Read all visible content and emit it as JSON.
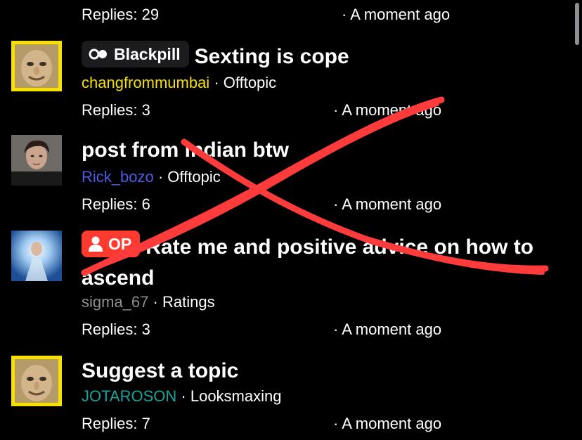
{
  "top_row": {
    "replies": "Replies: 29",
    "time": "· A moment ago"
  },
  "threads": [
    {
      "badge": "Blackpill",
      "title": "Sexting is cope",
      "author": "changfrommumbai",
      "author_color": "#f5e000",
      "category": "Offtopic",
      "replies": "Replies: 3",
      "time": "· A moment ago"
    },
    {
      "title": "post from indian btw",
      "author": "Rick_bozo",
      "author_color": "#4b5de8",
      "category": "Offtopic",
      "replies": "Replies: 6",
      "time": "· A moment ago"
    },
    {
      "badge": "OP",
      "title": "Rate me and positive advice on how to ascend",
      "author": "sigma_67",
      "author_color": "#8e8e93",
      "category": "Ratings",
      "replies": "Replies: 3",
      "time": "· A moment ago"
    },
    {
      "title": "Suggest a topic",
      "author": "JOTAROSON",
      "author_color": "#1aa39a",
      "category": "Looksmaxing",
      "replies": "Replies: 7",
      "time": "· A moment ago"
    }
  ],
  "separator": "·",
  "colors": {
    "background": "#000000",
    "scribble": "#ff3b3b",
    "badge_op": "#ff3b30",
    "badge_blackpill": "#1c1c1e"
  },
  "icons": [
    "pill-icon",
    "person-icon"
  ]
}
